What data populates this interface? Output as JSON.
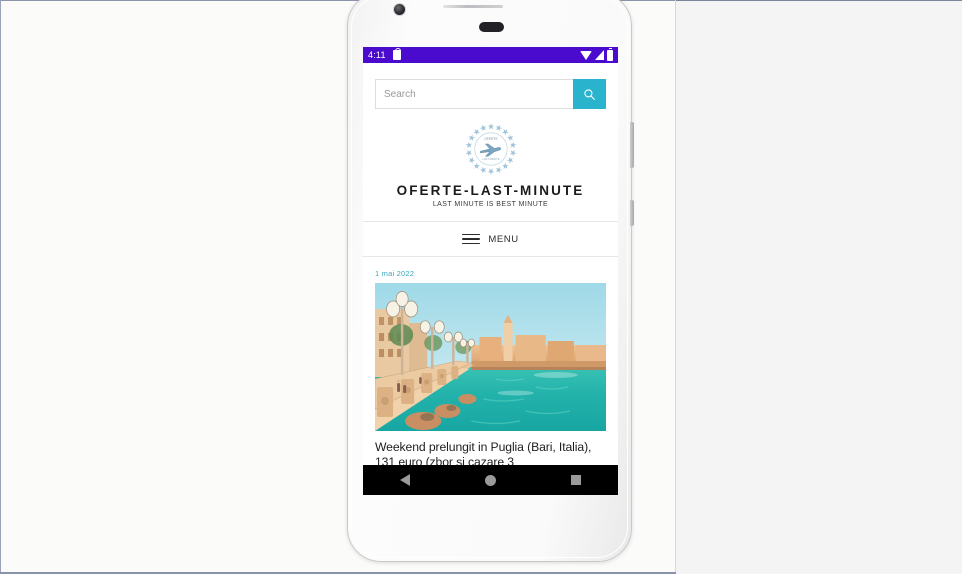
{
  "device": {
    "name": "android-phone-mockup",
    "camera_icon": "camera-dot-icon",
    "earpiece_icon": "earpiece-speaker-icon",
    "sensor_icon": "proximity-sensor-icon"
  },
  "status_bar": {
    "time": "4:11",
    "lock_icon": "lock-icon",
    "wifi_icon": "wifi-icon",
    "signal_icon": "signal-bars-icon",
    "battery_icon": "battery-icon",
    "background_color": "#4b0bcf"
  },
  "search": {
    "placeholder": "Search",
    "value": "",
    "button_icon": "search-icon",
    "button_color": "#29b3cd"
  },
  "brand": {
    "logo_icon": "airplane-circle-emblem-icon",
    "name": "OFERTE-LAST-MINUTE",
    "tagline": "LAST MINUTE IS BEST MINUTE"
  },
  "menu": {
    "icon": "hamburger-menu-icon",
    "label": "MENU"
  },
  "article": {
    "date": "1 mai 2022",
    "date_color": "#3aa6bd",
    "photo_alt": "bari-seafront-promenade-photo",
    "title": "Weekend prelungit in Puglia (Bari, Italia), 131 euro (zbor si cazare 3"
  },
  "nav_bar": {
    "back_icon": "back-triangle-icon",
    "home_icon": "home-circle-icon",
    "recents_icon": "recents-square-icon"
  }
}
